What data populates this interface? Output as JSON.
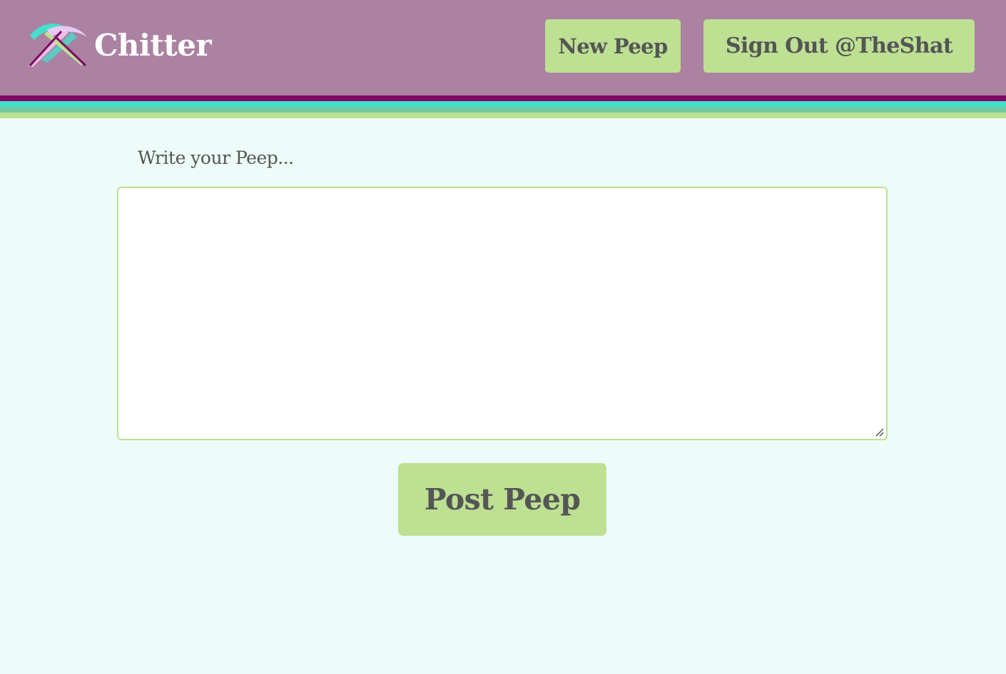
{
  "header": {
    "brand": "Chitter",
    "new_peep_label": "New Peep",
    "sign_out_label": "Sign Out @TheShat"
  },
  "form": {
    "label": "Write your Peep...",
    "peep_value": "",
    "placeholder": "",
    "submit_label": "Post Peep"
  },
  "colors": {
    "header_bg": "#ab82a2",
    "page_bg": "#edfcf8",
    "button_bg": "#bde093",
    "button_text": "#555555",
    "stripes": [
      "#820766",
      "#43e0cc",
      "#72c9a6",
      "#bde093"
    ]
  },
  "icons": {
    "logo": "chitter-logo-icon",
    "resize": "resize-grip-icon"
  }
}
